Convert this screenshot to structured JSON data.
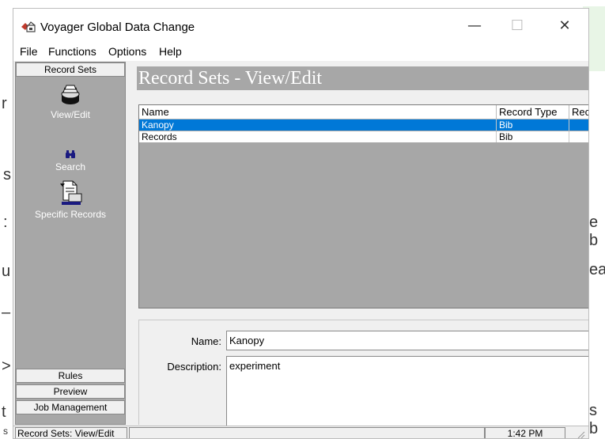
{
  "window": {
    "title": "Voyager Global Data Change",
    "controls": {
      "minimize": "—",
      "maximize": "☐",
      "close": "✕"
    }
  },
  "menu": [
    "File",
    "Functions",
    "Options",
    "Help"
  ],
  "left_panel": {
    "tab_top": "Record Sets",
    "nav": [
      {
        "label": "View/Edit",
        "icon": "record-stack-icon"
      },
      {
        "label": "Search",
        "icon": "binoculars-icon"
      },
      {
        "label": "Specific Records",
        "icon": "document-printer-icon"
      }
    ],
    "tabs_bottom": [
      "Rules",
      "Preview",
      "Job Management"
    ]
  },
  "main": {
    "header": "Record Sets - View/Edit",
    "table": {
      "columns": [
        "Name",
        "Record Type",
        "Rec"
      ],
      "rows": [
        {
          "name": "Kanopy",
          "type": "Bib",
          "rec": "",
          "selected": true
        },
        {
          "name": "Records",
          "type": "Bib",
          "rec": "",
          "selected": false
        }
      ]
    },
    "form": {
      "name_label": "Name:",
      "name_value": "Kanopy",
      "description_label": "Description:",
      "description_value": "experiment"
    }
  },
  "status": {
    "left": "Record Sets: View/Edit",
    "time": "1:42 PM"
  },
  "background_fragments": [
    "r",
    "s",
    ":",
    "u",
    "–",
    ">",
    "t",
    "e b",
    "ea",
    "s b",
    "s"
  ],
  "colors": {
    "panel_gray": "#a7a7a7",
    "selection_blue": "#0078d7",
    "window_bg": "#f0f0f0"
  }
}
